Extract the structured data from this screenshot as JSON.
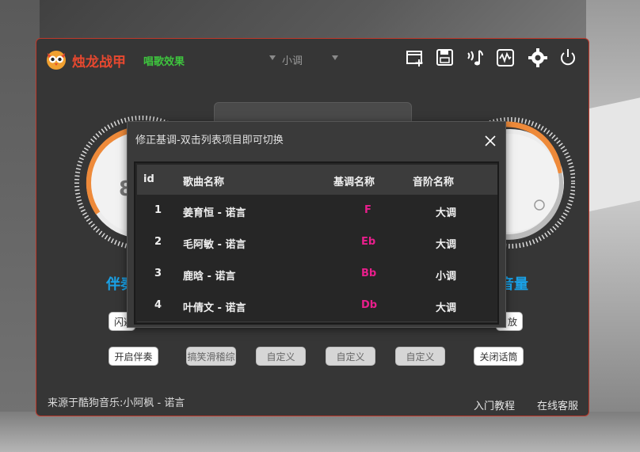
{
  "app": {
    "title": "烛龙战甲",
    "effect_label": "唱歌效果",
    "key_value": "小调",
    "source_text": "来源于酷狗音乐:小阿枫 - 诺言",
    "links": {
      "tutorial": "入门教程",
      "support": "在线客服"
    }
  },
  "knobs": {
    "left_label": "伴奏",
    "right_label": "音量",
    "left_value_partial": "8"
  },
  "buttons": {
    "row1": {
      "left_partial": "闪避",
      "right_partial": "放"
    },
    "row2": [
      {
        "label": "开启伴奏",
        "style": "white"
      },
      {
        "label": "搞笑滑稽综",
        "style": "gray"
      },
      {
        "label": "自定义",
        "style": "gray"
      },
      {
        "label": "自定义",
        "style": "gray"
      },
      {
        "label": "自定义",
        "style": "gray"
      },
      {
        "label": "关闭话筒",
        "style": "white"
      }
    ]
  },
  "toolbar": {
    "icons": [
      "add-window-icon",
      "save-icon",
      "music-note-icon",
      "equalizer-icon",
      "gear-icon",
      "power-icon"
    ]
  },
  "dialog": {
    "title": "修正基调-双击列表项目即可切换",
    "columns": {
      "id": "id",
      "song": "歌曲名称",
      "key": "基调名称",
      "scale": "音阶名称"
    },
    "rows": [
      {
        "id": "1",
        "song": "姜育恒 - 诺言",
        "key": "F",
        "scale": "大调"
      },
      {
        "id": "2",
        "song": "毛阿敏 - 诺言",
        "key": "Eb",
        "scale": "大调"
      },
      {
        "id": "3",
        "song": "鹿晗 - 诺言",
        "key": "Bb",
        "scale": "小调"
      },
      {
        "id": "4",
        "song": "叶倩文 - 诺言",
        "key": "Db",
        "scale": "大调"
      }
    ]
  },
  "colors": {
    "accent_red": "#e8482f",
    "accent_green": "#3ec43e",
    "accent_blue": "#1aa1e6",
    "key_pink": "#e91e8c"
  }
}
